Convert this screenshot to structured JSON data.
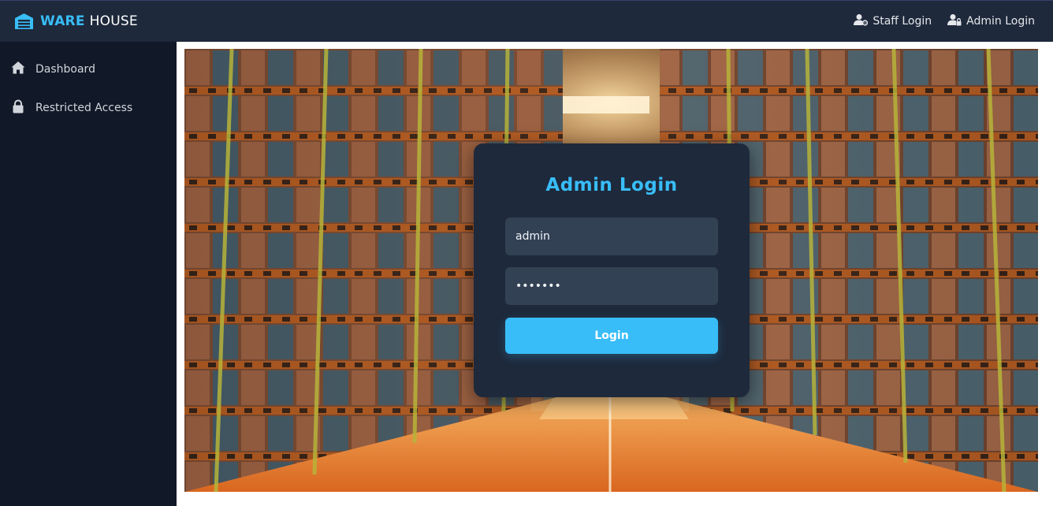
{
  "brand": {
    "part1": "WARE",
    "part2": "HOUSE",
    "icon": "warehouse-icon"
  },
  "nav": {
    "staff_login": "Staff Login",
    "admin_login": "Admin Login"
  },
  "sidebar": {
    "items": [
      {
        "label": "Dashboard",
        "icon": "home-icon"
      },
      {
        "label": "Restricted Access",
        "icon": "lock-icon"
      }
    ]
  },
  "login": {
    "title": "Admin Login",
    "username_value": "admin",
    "password_value": "•••••••",
    "button_label": "Login"
  },
  "colors": {
    "accent": "#38bdf8",
    "topbar": "#1e293b",
    "sidebar": "#111827",
    "card": "#1e293b",
    "input": "#334155"
  }
}
